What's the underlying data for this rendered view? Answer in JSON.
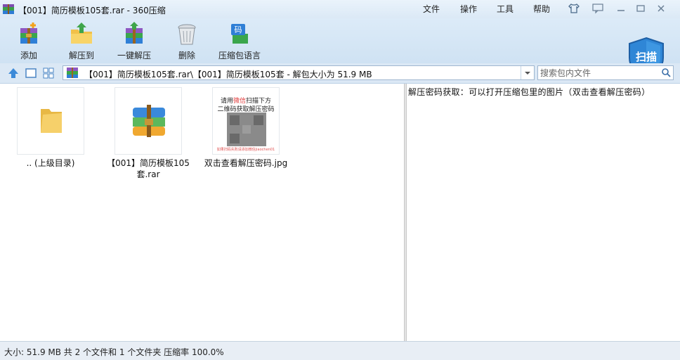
{
  "window": {
    "title": "【001】简历模板105套.rar - 360压缩",
    "menu": [
      "文件",
      "操作",
      "工具",
      "帮助"
    ]
  },
  "toolbar": {
    "buttons": [
      {
        "label": "添加",
        "icon": "add-archive-icon"
      },
      {
        "label": "解压到",
        "icon": "extract-to-icon"
      },
      {
        "label": "一键解压",
        "icon": "one-click-extract-icon"
      },
      {
        "label": "删除",
        "icon": "trash-icon"
      },
      {
        "label": "压缩包语言",
        "icon": "archive-language-icon"
      }
    ],
    "scan_label": "扫描"
  },
  "navbar": {
    "path": "【001】简历模板105套.rar\\【001】简历模板105套 - 解包大小为 51.9 MB",
    "search_placeholder": "搜索包内文件"
  },
  "files": [
    {
      "name": ".. (上级目录)",
      "type": "parent-folder"
    },
    {
      "name": "【001】简历模板105套.rar",
      "type": "rar-archive"
    },
    {
      "name": "双击查看解压密码.jpg",
      "type": "image"
    }
  ],
  "qr_thumb": {
    "line1_prefix": "请用",
    "line1_red": "微信",
    "line1_suffix": "扫描下方",
    "line2": "二维码获取解压密码",
    "footer": "如果扫码失败请添加微信jiaochen01"
  },
  "right_pane": {
    "text": "解压密码获取：可以打开压缩包里的图片（双击查看解压密码）"
  },
  "status": {
    "text": "大小: 51.9 MB 共 2 个文件和 1 个文件夹 压缩率 100.0%"
  },
  "colors": {
    "title_bg": "#dbe9f6",
    "toolbar_bg": "#cfe2f3",
    "scan_shield": "#2f86d6",
    "qr_red": "#e03b3b"
  }
}
